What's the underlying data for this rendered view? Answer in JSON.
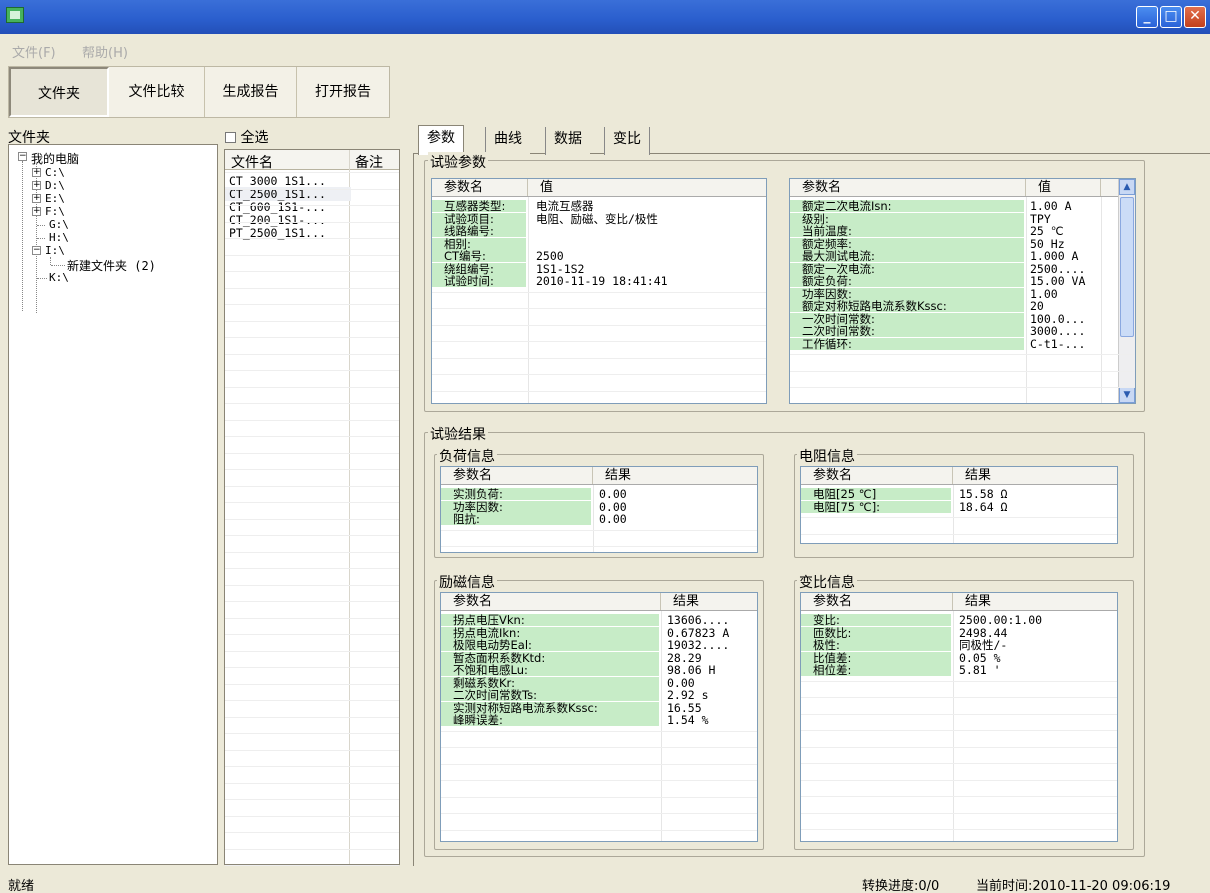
{
  "menu": {
    "file": "文件(F)",
    "help": "帮助(H)"
  },
  "toolbar": {
    "folder": "文件夹",
    "compare": "文件比较",
    "generate": "生成报告",
    "open": "打开报告"
  },
  "left": {
    "title": "文件夹",
    "root": "我的电脑",
    "drives": [
      "C:\\",
      "D:\\",
      "E:\\",
      "F:\\",
      "G:\\",
      "H:\\",
      "I:\\",
      "K:\\"
    ],
    "subfolder": "新建文件夹 (2)"
  },
  "middle": {
    "select_all": "全选",
    "col_name": "文件名",
    "col_note": "备注",
    "files": [
      "CT_3000_1S1...",
      "CT_2500_1S1...",
      "CT_600_1S1-...",
      "CT_200_1S1-...",
      "PT_2500_1S1..."
    ]
  },
  "tabs": [
    "参数",
    "曲线",
    "数据",
    "变比"
  ],
  "test_params": {
    "label": "试验参数",
    "col_name": "参数名",
    "col_value": "值",
    "left_rows": [
      {
        "k": "互感器类型:",
        "v": "电流互感器"
      },
      {
        "k": "试验项目:",
        "v": "电阻、励磁、变比/极性"
      },
      {
        "k": "线路编号:",
        "v": ""
      },
      {
        "k": "相别:",
        "v": ""
      },
      {
        "k": "CT编号:",
        "v": "2500"
      },
      {
        "k": "绕组编号:",
        "v": "1S1-1S2"
      },
      {
        "k": "试验时间:",
        "v": "2010-11-19 18:41:41"
      }
    ],
    "right_rows": [
      {
        "k": "额定二次电流Isn:",
        "v": "1.00 A"
      },
      {
        "k": "级别:",
        "v": "TPY"
      },
      {
        "k": "当前温度:",
        "v": "25 ℃"
      },
      {
        "k": "额定频率:",
        "v": "50 Hz"
      },
      {
        "k": "最大测试电流:",
        "v": "1.000 A"
      },
      {
        "k": "额定一次电流:",
        "v": "2500...."
      },
      {
        "k": "额定负荷:",
        "v": "15.00 VA"
      },
      {
        "k": "功率因数:",
        "v": "1.00"
      },
      {
        "k": "额定对称短路电流系数Kssc:",
        "v": "20"
      },
      {
        "k": "一次时间常数:",
        "v": "100.0..."
      },
      {
        "k": "二次时间常数:",
        "v": "3000...."
      },
      {
        "k": "工作循环:",
        "v": "C-t1-..."
      }
    ]
  },
  "results": {
    "label": "试验结果",
    "col_name": "参数名",
    "col_result": "结果",
    "load": {
      "label": "负荷信息",
      "rows": [
        {
          "k": "实测负荷:",
          "v": "0.00"
        },
        {
          "k": "功率因数:",
          "v": "0.00"
        },
        {
          "k": "阻抗:",
          "v": "0.00"
        }
      ]
    },
    "resistance": {
      "label": "电阻信息",
      "rows": [
        {
          "k": "电阻[25 ℃]",
          "v": "15.58 Ω"
        },
        {
          "k": "电阻[75 ℃]:",
          "v": "18.64 Ω"
        }
      ]
    },
    "excitation": {
      "label": "励磁信息",
      "rows": [
        {
          "k": "拐点电压Vkn:",
          "v": "13606...."
        },
        {
          "k": "拐点电流Ikn:",
          "v": "0.67823 A"
        },
        {
          "k": "极限电动势Eal:",
          "v": "19032...."
        },
        {
          "k": "暂态面积系数Ktd:",
          "v": "28.29"
        },
        {
          "k": "不饱和电感Lu:",
          "v": "98.06 H"
        },
        {
          "k": "剩磁系数Kr:",
          "v": "0.00"
        },
        {
          "k": "二次时间常数Ts:",
          "v": "2.92 s"
        },
        {
          "k": "实测对称短路电流系数Kssc:",
          "v": "16.55"
        },
        {
          "k": "峰瞬误差:",
          "v": "1.54 %"
        }
      ]
    },
    "ratio": {
      "label": "变比信息",
      "rows": [
        {
          "k": "变比:",
          "v": "2500.00:1.00"
        },
        {
          "k": "匝数比:",
          "v": "2498.44"
        },
        {
          "k": "极性:",
          "v": "同极性/-"
        },
        {
          "k": "比值差:",
          "v": "0.05 %"
        },
        {
          "k": "相位差:",
          "v": "5.81 '"
        }
      ]
    }
  },
  "status": {
    "ready": "就绪",
    "progress": "转换进度:0/0",
    "time": "当前时间:2010-11-20 09:06:19"
  }
}
